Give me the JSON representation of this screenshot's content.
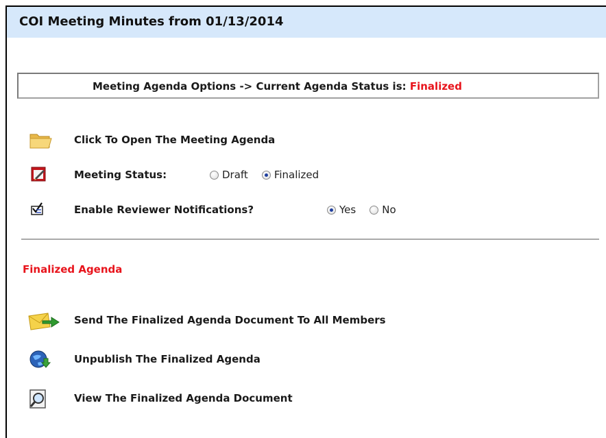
{
  "header": {
    "title": "COI Meeting Minutes from 01/13/2014"
  },
  "agenda_options": {
    "prefix": "Meeting Agenda Options -> Current Agenda Status is: ",
    "status": "Finalized"
  },
  "open_agenda": {
    "label": "Click To Open The Meeting Agenda",
    "icon": "folder-icon"
  },
  "meeting_status": {
    "label": "Meeting Status:",
    "icon": "calendar-edit-icon",
    "options": [
      {
        "label": "Draft",
        "selected": false
      },
      {
        "label": "Finalized",
        "selected": true
      }
    ]
  },
  "reviewer_notifications": {
    "label": "Enable Reviewer Notifications?",
    "icon": "checklist-icon",
    "options": [
      {
        "label": "Yes",
        "selected": true
      },
      {
        "label": "No",
        "selected": false
      }
    ]
  },
  "finalized_section": {
    "heading": "Finalized Agenda",
    "actions": [
      {
        "label": "Send The Finalized Agenda Document To All Members",
        "icon": "send-mail-icon"
      },
      {
        "label": "Unpublish The Finalized Agenda",
        "icon": "globe-download-icon"
      },
      {
        "label": "View The Finalized Agenda Document",
        "icon": "document-magnifier-icon"
      }
    ]
  },
  "colors": {
    "header_bg": "#d6e8fb",
    "status_red": "#e8141c",
    "radio_dot": "#1f3f9e"
  }
}
